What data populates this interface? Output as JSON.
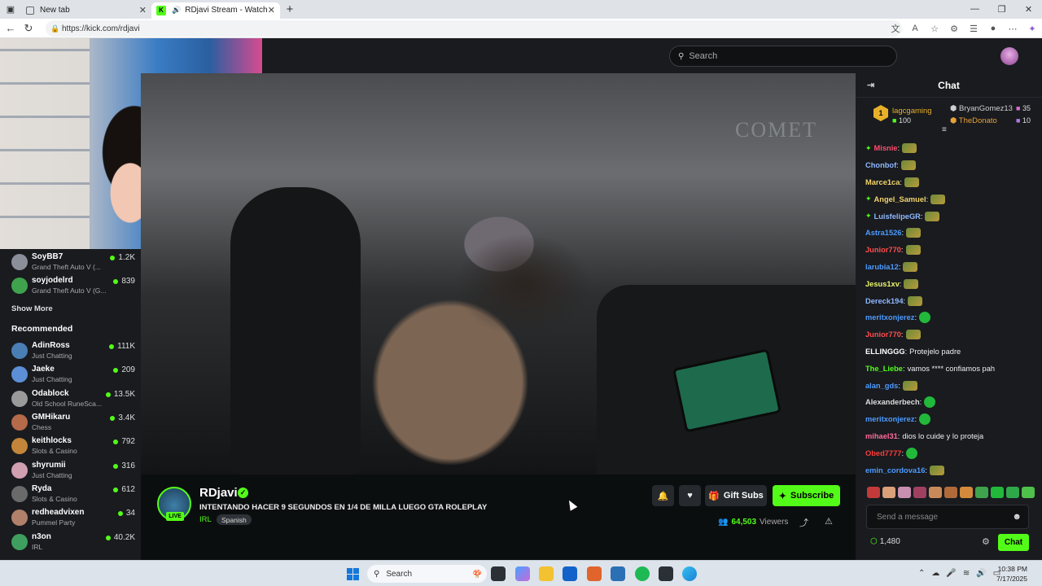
{
  "browser": {
    "tabs": [
      {
        "title": "New tab",
        "active": false
      },
      {
        "title": "RDjavi Stream - Watch Live o",
        "active": true
      }
    ],
    "url": "https://kick.com/rdjavi"
  },
  "kick": {
    "search_placeholder": "Search",
    "sidebar": {
      "followed": [
        {
          "name": "SoyBB7",
          "game": "Grand Theft Auto V (...",
          "viewers": "1.2K",
          "color": "#8a8f9a"
        },
        {
          "name": "soyjodelrd",
          "game": "Grand Theft Auto V (G...",
          "viewers": "839",
          "color": "#3fa34d"
        }
      ],
      "show_more": "Show More",
      "recommended_label": "Recommended",
      "recommended": [
        {
          "name": "AdinRoss",
          "game": "Just Chatting",
          "viewers": "111K",
          "color": "#4a7fb5"
        },
        {
          "name": "Jaeke",
          "game": "Just Chatting",
          "viewers": "209",
          "color": "#5c8fd6"
        },
        {
          "name": "Odablock",
          "game": "Old School RuneSca...",
          "viewers": "13.5K",
          "color": "#9a9a9a"
        },
        {
          "name": "GMHikaru",
          "game": "Chess",
          "viewers": "3.4K",
          "color": "#b56a4a"
        },
        {
          "name": "keithlocks",
          "game": "Slots & Casino",
          "viewers": "792",
          "color": "#c2853a"
        },
        {
          "name": "shyrumii",
          "game": "Just Chatting",
          "viewers": "316",
          "color": "#d0a0b0"
        },
        {
          "name": "Ryda",
          "game": "Slots & Casino",
          "viewers": "612",
          "color": "#6a6a6a"
        },
        {
          "name": "redheadvixen",
          "game": "Pummel Party",
          "viewers": "34",
          "color": "#b0806a"
        },
        {
          "name": "n3on",
          "game": "IRL",
          "viewers": "40.2K",
          "color": "#3f9f5f"
        }
      ]
    },
    "stream": {
      "streamer": "RDjavi",
      "live_badge": "LIVE",
      "title": "INTENTANDO HACER 9 SEGUNDOS EN 1/4 DE MILLA  LUEGO GTA ROLEPLAY",
      "category": "IRL",
      "language": "Spanish",
      "viewers": "64,503",
      "viewers_label": "Viewers",
      "gift_subs": "Gift Subs",
      "subscribe": "Subscribe",
      "video_sign": "COMET"
    },
    "chat": {
      "title": "Chat",
      "leaderboard": [
        {
          "name": "lagcgaming",
          "value": "100",
          "rank": "1",
          "color": "#e8b02a"
        },
        {
          "name": "BryanGomez13",
          "value": "35",
          "color": "#cfcfcf"
        },
        {
          "name": "TheDonato",
          "value": "10",
          "color": "#e8a23a"
        }
      ],
      "messages": [
        {
          "user": "Misnie",
          "color": "#ff4d6d",
          "text": "",
          "emote": "frog",
          "badge": true
        },
        {
          "user": "Chonbof",
          "color": "#8fb8ff",
          "text": "",
          "emote": "frog"
        },
        {
          "user": "Marce1ca",
          "color": "#f2d36b",
          "text": "",
          "emote": "frog"
        },
        {
          "user": "Angel_Samuel",
          "color": "#f2d36b",
          "text": "",
          "emote": "frog",
          "badge": true
        },
        {
          "user": "LuisfelipeGR",
          "color": "#8fb8ff",
          "text": "",
          "emote": "frog",
          "badge": true
        },
        {
          "user": "Astra1526",
          "color": "#4d9bff",
          "text": "",
          "emote": "frog"
        },
        {
          "user": "Junior770",
          "color": "#ff4d4d",
          "text": "",
          "emote": "frog"
        },
        {
          "user": "larubia12",
          "color": "#4d9bff",
          "text": "",
          "emote": "frog"
        },
        {
          "user": "Jesus1xv",
          "color": "#eaf56b",
          "text": "",
          "emote": "frog"
        },
        {
          "user": "Dereck194",
          "color": "#8fb8ff",
          "text": "",
          "emote": "frog"
        },
        {
          "user": "meritxonjerez",
          "color": "#4d9bff",
          "text": "",
          "emote": "green"
        },
        {
          "user": "Junior770",
          "color": "#ff4d4d",
          "text": "",
          "emote": "frog"
        },
        {
          "user": "ELLINGGG",
          "color": "#ffffff",
          "text": "Protejelo padre",
          "emote": ""
        },
        {
          "user": "The_Liebe",
          "color": "#53fc18",
          "text": "vamos **** confiamos pah",
          "emote": ""
        },
        {
          "user": "alan_gds",
          "color": "#4d9bff",
          "text": "",
          "emote": "frog"
        },
        {
          "user": "Alexanderbech",
          "color": "#dddddd",
          "text": "",
          "emote": "green"
        },
        {
          "user": "meritxonjerez",
          "color": "#4d9bff",
          "text": "",
          "emote": "green"
        },
        {
          "user": "mihael31",
          "color": "#ff6b9a",
          "text": "dios lo cuide y lo proteja",
          "emote": ""
        },
        {
          "user": "Obed7777",
          "color": "#ff3b3b",
          "text": "",
          "emote": "green"
        },
        {
          "user": "emin_cordova16",
          "color": "#4d9bff",
          "text": "",
          "emote": "frog"
        }
      ],
      "input_placeholder": "Send a message",
      "points": "1,480",
      "send_label": "Chat"
    }
  },
  "taskbar": {
    "search": "Search",
    "time": "10:38 PM",
    "date": "7/17/2025"
  }
}
